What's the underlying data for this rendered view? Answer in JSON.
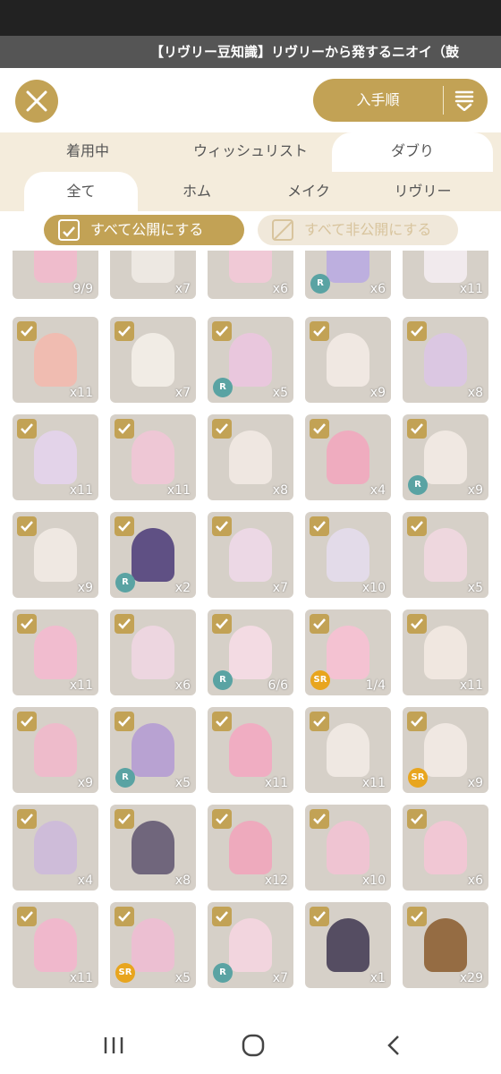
{
  "ticker": {
    "text": "【リヴリー豆知識】リヴリーから発するニオイ（鼓"
  },
  "header": {
    "sort_label": "入手順",
    "close_icon": "close-icon",
    "sort_icon": "sort-icon"
  },
  "tabs_top": [
    {
      "label": "着用中"
    },
    {
      "label": "ウィッシュリスト"
    },
    {
      "label": "ダブり"
    }
  ],
  "tabs_sub": [
    {
      "label": "全て"
    },
    {
      "label": "ホム"
    },
    {
      "label": "メイク"
    },
    {
      "label": "リヴリー"
    }
  ],
  "actions": {
    "public_all": "すべて公開にする",
    "private_all": "すべて非公開にする"
  },
  "colors": {
    "accent": "#c2a255",
    "rarity_R": "#5aa3a3",
    "rarity_SR": "#e8a51e"
  },
  "items": [
    {
      "count": "9/9",
      "checked": false,
      "badge": "",
      "tint": "#f3b9cc"
    },
    {
      "count": "x7",
      "checked": false,
      "badge": "",
      "tint": "#f1ece6"
    },
    {
      "count": "x6",
      "checked": false,
      "badge": "",
      "tint": "#f5c8d8"
    },
    {
      "count": "x6",
      "checked": false,
      "badge": "R",
      "tint": "#b9a9e3"
    },
    {
      "count": "x11",
      "checked": false,
      "badge": "",
      "tint": "#f6eef3"
    },
    {
      "count": "x11",
      "checked": true,
      "badge": "",
      "tint": "#f4b8ad"
    },
    {
      "count": "x7",
      "checked": true,
      "badge": "",
      "tint": "#f6f1ea"
    },
    {
      "count": "x5",
      "checked": true,
      "badge": "R",
      "tint": "#ecc6e0"
    },
    {
      "count": "x9",
      "checked": true,
      "badge": "",
      "tint": "#f4ece6"
    },
    {
      "count": "x8",
      "checked": true,
      "badge": "",
      "tint": "#dcc5e6"
    },
    {
      "count": "x11",
      "checked": true,
      "badge": "",
      "tint": "#e5d3ee"
    },
    {
      "count": "x11",
      "checked": true,
      "badge": "",
      "tint": "#f2c6d7"
    },
    {
      "count": "x8",
      "checked": true,
      "badge": "",
      "tint": "#f3ebe5"
    },
    {
      "count": "x4",
      "checked": true,
      "badge": "",
      "tint": "#f3a6bd"
    },
    {
      "count": "x9",
      "checked": true,
      "badge": "R",
      "tint": "#f4ece6"
    },
    {
      "count": "x9",
      "checked": true,
      "badge": "",
      "tint": "#f3ece6"
    },
    {
      "count": "x2",
      "checked": true,
      "badge": "R",
      "tint": "#4a3a78"
    },
    {
      "count": "x7",
      "checked": true,
      "badge": "",
      "tint": "#f0d9ea"
    },
    {
      "count": "x10",
      "checked": true,
      "badge": "",
      "tint": "#e5ddee"
    },
    {
      "count": "x5",
      "checked": true,
      "badge": "",
      "tint": "#f2d8e2"
    },
    {
      "count": "x11",
      "checked": true,
      "badge": "",
      "tint": "#f6b8d0"
    },
    {
      "count": "x6",
      "checked": true,
      "badge": "",
      "tint": "#f1d7e4"
    },
    {
      "count": "6/6",
      "checked": true,
      "badge": "R",
      "tint": "#f8dde8"
    },
    {
      "count": "1/4",
      "checked": true,
      "badge": "SR",
      "tint": "#f9bfd3"
    },
    {
      "count": "x11",
      "checked": true,
      "badge": "",
      "tint": "#f4ebe4"
    },
    {
      "count": "x9",
      "checked": true,
      "badge": "",
      "tint": "#f2b7cb"
    },
    {
      "count": "x5",
      "checked": true,
      "badge": "R",
      "tint": "#b39ad3"
    },
    {
      "count": "x11",
      "checked": true,
      "badge": "",
      "tint": "#f4a7c1"
    },
    {
      "count": "x11",
      "checked": true,
      "badge": "",
      "tint": "#f3ece6"
    },
    {
      "count": "x9",
      "checked": true,
      "badge": "SR",
      "tint": "#f4ece6"
    },
    {
      "count": "x4",
      "checked": true,
      "badge": "",
      "tint": "#cdb9dc"
    },
    {
      "count": "x8",
      "checked": true,
      "badge": "",
      "tint": "#5e536e"
    },
    {
      "count": "x12",
      "checked": true,
      "badge": "",
      "tint": "#f2a3bb"
    },
    {
      "count": "x10",
      "checked": true,
      "badge": "",
      "tint": "#f3c2d4"
    },
    {
      "count": "x6",
      "checked": true,
      "badge": "",
      "tint": "#f6c6d6"
    },
    {
      "count": "x11",
      "checked": true,
      "badge": "",
      "tint": "#f5b4cc"
    },
    {
      "count": "x5",
      "checked": true,
      "badge": "SR",
      "tint": "#f0bcd4"
    },
    {
      "count": "x7",
      "checked": true,
      "badge": "R",
      "tint": "#f7d6e2"
    },
    {
      "count": "x1",
      "checked": true,
      "badge": "",
      "tint": "#3e3650"
    },
    {
      "count": "x29",
      "checked": true,
      "badge": "",
      "tint": "#8a5a2c"
    }
  ]
}
